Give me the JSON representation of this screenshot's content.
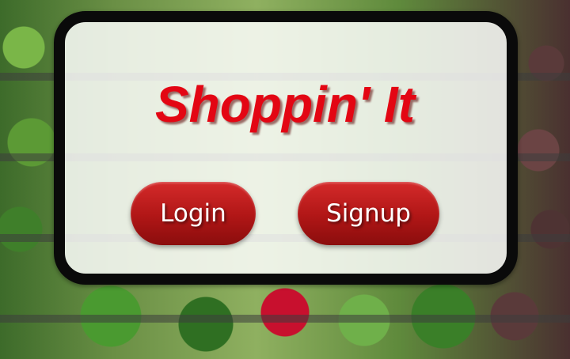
{
  "app": {
    "title": "Shoppin' It"
  },
  "actions": {
    "login_label": "Login",
    "signup_label": "Signup"
  },
  "colors": {
    "title": "#e30613",
    "button": "#b01616",
    "card_border": "#0a0a0a",
    "card_fill": "#ffffff"
  },
  "background": {
    "description_icon": "produce-shelf-image"
  }
}
